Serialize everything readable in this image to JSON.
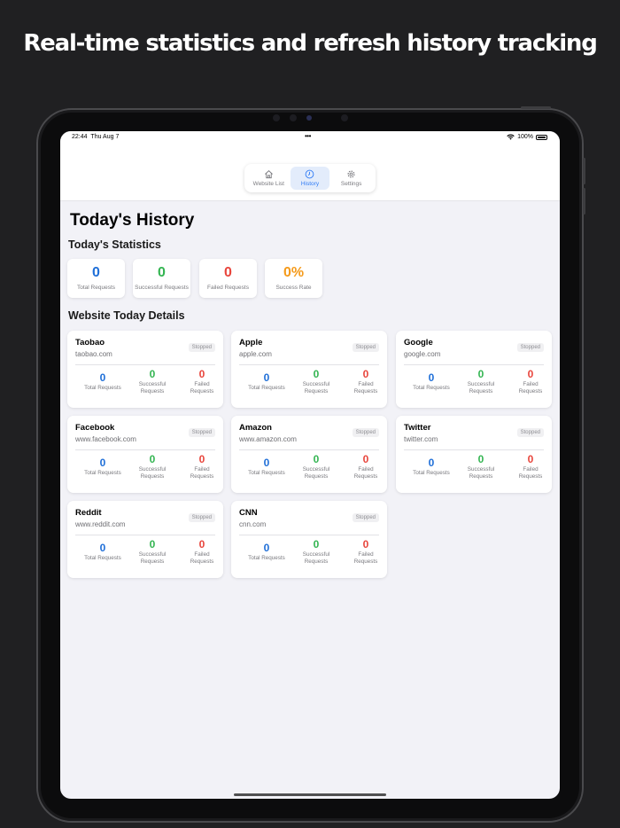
{
  "headline": "Real-time statistics and refresh history tracking",
  "status_bar": {
    "time": "22:44",
    "date": "Thu Aug 7",
    "battery": "100%"
  },
  "tabs": [
    {
      "label": "Website List",
      "icon": "house-icon",
      "active": false
    },
    {
      "label": "History",
      "icon": "clock-icon",
      "active": true
    },
    {
      "label": "Settings",
      "icon": "gear-icon",
      "active": false
    }
  ],
  "page_title": "Today's History",
  "statistics": {
    "title": "Today's Statistics",
    "cards": [
      {
        "value": "0",
        "label": "Total Requests",
        "color": "#1f6fd8"
      },
      {
        "value": "0",
        "label": "Successful Requests",
        "color": "#34b552"
      },
      {
        "value": "0",
        "label": "Failed Requests",
        "color": "#e8453c"
      },
      {
        "value": "0%",
        "label": "Success Rate",
        "color": "#f59a1a"
      }
    ]
  },
  "details": {
    "title": "Website Today Details",
    "metric_labels": {
      "total": "Total Requests",
      "success_1": "Successful",
      "success_2": "Requests",
      "failed_1": "Failed",
      "failed_2": "Requests"
    },
    "sites": [
      {
        "name": "Taobao",
        "url": "taobao.com",
        "status": "Stopped",
        "total": "0",
        "success": "0",
        "failed": "0"
      },
      {
        "name": "Apple",
        "url": "apple.com",
        "status": "Stopped",
        "total": "0",
        "success": "0",
        "failed": "0"
      },
      {
        "name": "Google",
        "url": "google.com",
        "status": "Stopped",
        "total": "0",
        "success": "0",
        "failed": "0"
      },
      {
        "name": "Facebook",
        "url": "www.facebook.com",
        "status": "Stopped",
        "total": "0",
        "success": "0",
        "failed": "0"
      },
      {
        "name": "Amazon",
        "url": "www.amazon.com",
        "status": "Stopped",
        "total": "0",
        "success": "0",
        "failed": "0"
      },
      {
        "name": "Twitter",
        "url": "twitter.com",
        "status": "Stopped",
        "total": "0",
        "success": "0",
        "failed": "0"
      },
      {
        "name": "Reddit",
        "url": "www.reddit.com",
        "status": "Stopped",
        "total": "0",
        "success": "0",
        "failed": "0"
      },
      {
        "name": "CNN",
        "url": "cnn.com",
        "status": "Stopped",
        "total": "0",
        "success": "0",
        "failed": "0"
      }
    ]
  }
}
